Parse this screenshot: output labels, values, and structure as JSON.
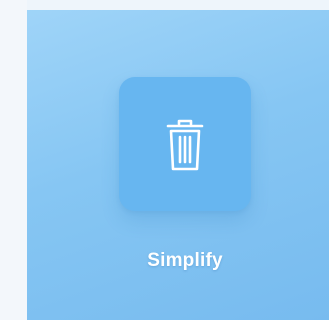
{
  "app_tile": {
    "label": "Simplify",
    "icon": "trash-icon",
    "colors": {
      "panel": "#86c6f3",
      "tile": "#67b6f0",
      "icon": "#ffffff",
      "label": "#ffffff"
    }
  }
}
